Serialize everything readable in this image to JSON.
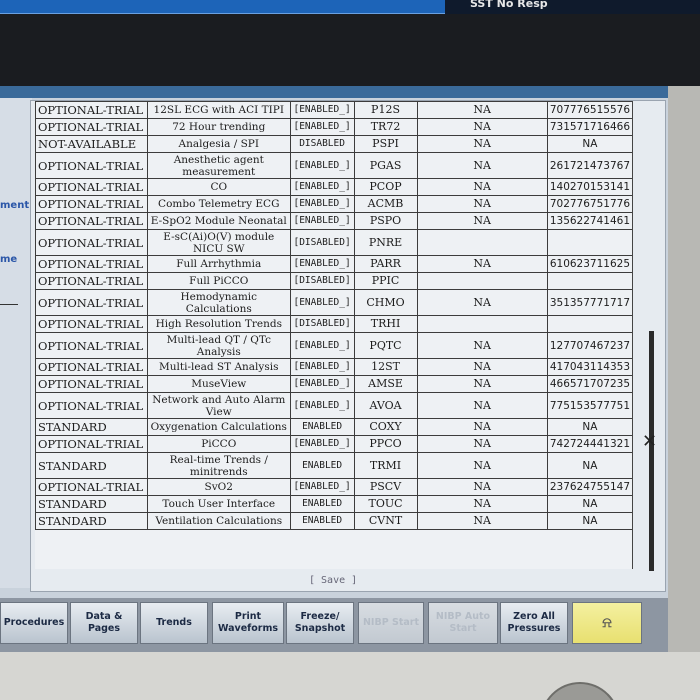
{
  "top_bar": {
    "status_text": "SST No Resp"
  },
  "left_panel": {
    "label_1": "ment",
    "label_2": "me"
  },
  "options": [
    {
      "license": "OPTIONAL-TRIAL",
      "name": "12SL ECG with ACI TIPI",
      "state": "[ENABLED_]",
      "code": "P12S",
      "na": "NA",
      "key": "707776515576"
    },
    {
      "license": "OPTIONAL-TRIAL",
      "name": "72 Hour trending",
      "state": "[ENABLED_]",
      "code": "TR72",
      "na": "NA",
      "key": "731571716466"
    },
    {
      "license": "NOT-AVAILABLE",
      "name": "Analgesia / SPI",
      "state": "DISABLED",
      "code": "PSPI",
      "na": "NA",
      "key": "NA"
    },
    {
      "license": "OPTIONAL-TRIAL",
      "name": "Anesthetic agent measurement",
      "state": "[ENABLED_]",
      "code": "PGAS",
      "na": "NA",
      "key": "261721473767"
    },
    {
      "license": "OPTIONAL-TRIAL",
      "name": "CO",
      "state": "[ENABLED_]",
      "code": "PCOP",
      "na": "NA",
      "key": "140270153141"
    },
    {
      "license": "OPTIONAL-TRIAL",
      "name": "Combo Telemetry ECG",
      "state": "[ENABLED_]",
      "code": "ACMB",
      "na": "NA",
      "key": "702776751776"
    },
    {
      "license": "OPTIONAL-TRIAL",
      "name": "E-SpO2 Module Neonatal",
      "state": "[ENABLED_]",
      "code": "PSPO",
      "na": "NA",
      "key": "135622741461"
    },
    {
      "license": "OPTIONAL-TRIAL",
      "name": "E-sC(Ai)O(V) module NICU SW",
      "state": "[DISABLED]",
      "code": "PNRE",
      "na": "",
      "key": ""
    },
    {
      "license": "OPTIONAL-TRIAL",
      "name": "Full Arrhythmia",
      "state": "[ENABLED_]",
      "code": "PARR",
      "na": "NA",
      "key": "610623711625"
    },
    {
      "license": "OPTIONAL-TRIAL",
      "name": "Full PiCCO",
      "state": "[DISABLED]",
      "code": "PPIC",
      "na": "",
      "key": ""
    },
    {
      "license": "OPTIONAL-TRIAL",
      "name": "Hemodynamic Calculations",
      "state": "[ENABLED_]",
      "code": "CHMO",
      "na": "NA",
      "key": "351357771717"
    },
    {
      "license": "OPTIONAL-TRIAL",
      "name": "High Resolution Trends",
      "state": "[DISABLED]",
      "code": "TRHI",
      "na": "",
      "key": ""
    },
    {
      "license": "OPTIONAL-TRIAL",
      "name": "Multi-lead QT / QTc Analysis",
      "state": "[ENABLED_]",
      "code": "PQTC",
      "na": "NA",
      "key": "127707467237"
    },
    {
      "license": "OPTIONAL-TRIAL",
      "name": "Multi-lead ST Analysis",
      "state": "[ENABLED_]",
      "code": "12ST",
      "na": "NA",
      "key": "417043114353"
    },
    {
      "license": "OPTIONAL-TRIAL",
      "name": "MuseView",
      "state": "[ENABLED_]",
      "code": "AMSE",
      "na": "NA",
      "key": "466571707235"
    },
    {
      "license": "OPTIONAL-TRIAL",
      "name": "Network and Auto Alarm View",
      "state": "[ENABLED_]",
      "code": "AVOA",
      "na": "NA",
      "key": "775153577751"
    },
    {
      "license": "STANDARD",
      "name": "Oxygenation Calculations",
      "state": "ENABLED",
      "code": "COXY",
      "na": "NA",
      "key": "NA"
    },
    {
      "license": "OPTIONAL-TRIAL",
      "name": "PiCCO",
      "state": "[ENABLED_]",
      "code": "PPCO",
      "na": "NA",
      "key": "742724441321"
    },
    {
      "license": "STANDARD",
      "name": "Real-time Trends / minitrends",
      "state": "ENABLED",
      "code": "TRMI",
      "na": "NA",
      "key": "NA"
    },
    {
      "license": "OPTIONAL-TRIAL",
      "name": "SvO2",
      "state": "[ENABLED_]",
      "code": "PSCV",
      "na": "NA",
      "key": "237624755147"
    },
    {
      "license": "STANDARD",
      "name": "Touch User Interface",
      "state": "ENABLED",
      "code": "TOUC",
      "na": "NA",
      "key": "NA"
    },
    {
      "license": "STANDARD",
      "name": "Ventilation Calculations",
      "state": "ENABLED",
      "code": "CVNT",
      "na": "NA",
      "key": "NA"
    }
  ],
  "save_label": "[ Save ]",
  "function_keys": {
    "procedures": "Procedures",
    "data_pages": "Data & Pages",
    "trends": "Trends",
    "print_waveforms": "Print Waveforms",
    "freeze_snapshot": "Freeze/ Snapshot",
    "nibp_start": "NIBP Start",
    "nibp_auto_start": "NIBP Auto Start",
    "zero_all_pressures": "Zero All Pressures",
    "alarm_icon": "bell-alarm-icon"
  }
}
